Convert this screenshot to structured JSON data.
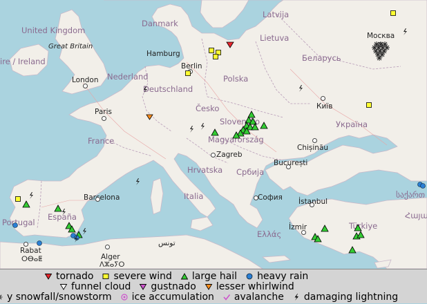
{
  "map": {
    "countries": [
      {
        "id": "latvija",
        "label": "Latvija"
      },
      {
        "id": "danmark",
        "label": "Danmark"
      },
      {
        "id": "uk",
        "label": "United Kingdom"
      },
      {
        "id": "lietuva",
        "label": "Lietuva"
      },
      {
        "id": "belarus",
        "label": "Беларусь"
      },
      {
        "id": "ireland",
        "label": "ire / Ireland"
      },
      {
        "id": "nederland",
        "label": "Nederland"
      },
      {
        "id": "deutschland",
        "label": "Deutschland"
      },
      {
        "id": "polska",
        "label": "Polska"
      },
      {
        "id": "cesko",
        "label": "Česko"
      },
      {
        "id": "ukraina",
        "label": "Україна"
      },
      {
        "id": "slovensko",
        "label": "Slovensko"
      },
      {
        "id": "france",
        "label": "France"
      },
      {
        "id": "magyar",
        "label": "Magyarország"
      },
      {
        "id": "hrvatska",
        "label": "Hrvatska"
      },
      {
        "id": "srbija",
        "label": "Србија"
      },
      {
        "id": "italia",
        "label": "Italia"
      },
      {
        "id": "portugal",
        "label": "Portugal"
      },
      {
        "id": "espana",
        "label": "España"
      },
      {
        "id": "ellas",
        "label": "Ελλάς"
      },
      {
        "id": "turkiye",
        "label": "Türkiye"
      },
      {
        "id": "georgia",
        "label": "საქართ"
      },
      {
        "id": "armenia",
        "label": "Հայաս"
      }
    ],
    "cities": [
      {
        "id": "moskva",
        "label": "Москва"
      },
      {
        "id": "hamburg",
        "label": "Hamburg"
      },
      {
        "id": "berlin",
        "label": "Berlin"
      },
      {
        "id": "london",
        "label": "London"
      },
      {
        "id": "paris",
        "label": "Paris"
      },
      {
        "id": "kyiv",
        "label": "Київ"
      },
      {
        "id": "zagreb",
        "label": "Zagreb"
      },
      {
        "id": "chisinau",
        "label": "Chișinău"
      },
      {
        "id": "bucuresti",
        "label": "București"
      },
      {
        "id": "sofia",
        "label": "София"
      },
      {
        "id": "istanbul",
        "label": "İstanbul"
      },
      {
        "id": "izmir",
        "label": "İzmir"
      },
      {
        "id": "barcelona",
        "label": "Barcelona"
      },
      {
        "id": "rabat",
        "label": "Rabat"
      },
      {
        "id": "alger",
        "label": "Alger"
      },
      {
        "id": "tunis",
        "label": "تونس"
      },
      {
        "id": "greatbritain",
        "label": "Great Britain"
      },
      {
        "id": "berber1",
        "label": "ⵔⴱⴰⵟ"
      },
      {
        "id": "berber2",
        "label": "ⴷⵣⴰⵢⵔ"
      }
    ]
  },
  "legend": {
    "row1": [
      {
        "id": "tornado",
        "label": "tornado",
        "symbol": "triangle-down",
        "color": "#e8262d"
      },
      {
        "id": "severe-wind",
        "label": "severe wind",
        "symbol": "square",
        "color": "#ffff33"
      },
      {
        "id": "large-hail",
        "label": "large hail",
        "symbol": "triangle-up",
        "color": "#33cc33"
      },
      {
        "id": "heavy-rain",
        "label": "heavy rain",
        "symbol": "circle",
        "color": "#2a7fd4"
      }
    ],
    "row2": [
      {
        "id": "funnel-cloud",
        "label": "funnel cloud",
        "symbol": "triangle-down",
        "color": "#ffffff"
      },
      {
        "id": "gustnado",
        "label": "gustnado",
        "symbol": "triangle-down",
        "color": "#cc55cc"
      },
      {
        "id": "lesser-whirlwind",
        "label": "lesser whirlwind",
        "symbol": "triangle-down",
        "color": "#ff8c1a"
      }
    ],
    "row3": [
      {
        "id": "heavy-snowfall",
        "label": "y snowfall/snowstorm",
        "symbol": "star",
        "color": "#ffffff"
      },
      {
        "id": "ice-accumulation",
        "label": "ice accumulation",
        "symbol": "ice",
        "color": "#cc55cc"
      },
      {
        "id": "avalanche",
        "label": "avalanche",
        "symbol": "check",
        "color": "#cc55cc"
      },
      {
        "id": "damaging-lightning",
        "label": "damaging lightning",
        "symbol": "bolt",
        "color": "#000000"
      }
    ]
  }
}
